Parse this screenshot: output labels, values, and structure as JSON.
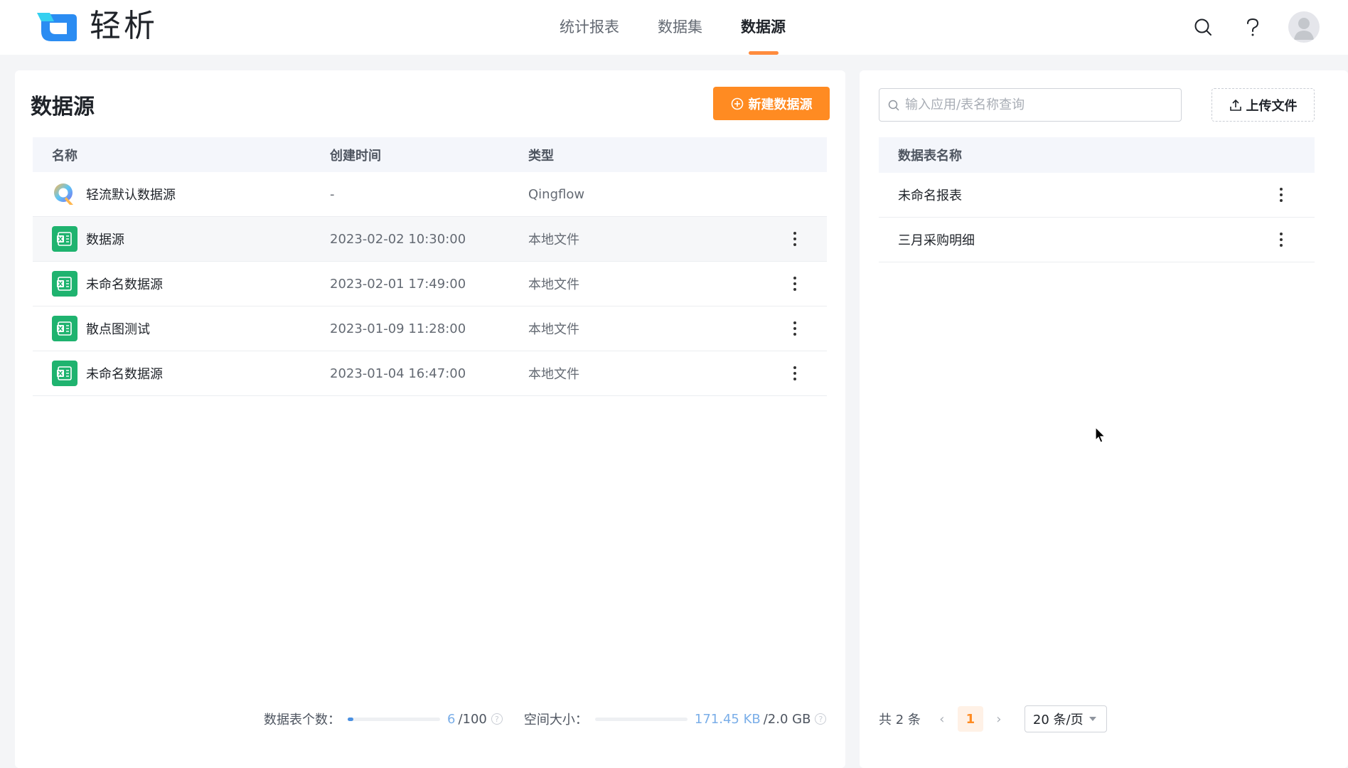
{
  "app": {
    "logo_text": "轻析",
    "nav": [
      {
        "label": "统计报表",
        "active": false
      },
      {
        "label": "数据集",
        "active": false
      },
      {
        "label": "数据源",
        "active": true
      }
    ],
    "accent_color": "#ff8b22",
    "icons": [
      "search-icon",
      "help-icon",
      "avatar"
    ]
  },
  "left": {
    "title": "数据源",
    "new_button_label": "新建数据源",
    "columns": [
      "名称",
      "创建时间",
      "类型"
    ],
    "rows": [
      {
        "icon": "qingflow-icon",
        "name": "轻流默认数据源",
        "time": "-",
        "type": "Qingflow",
        "has_more": false
      },
      {
        "icon": "excel-icon",
        "name": "数据源",
        "time": "2023-02-02 10:30:00",
        "type": "本地文件",
        "has_more": true
      },
      {
        "icon": "excel-icon",
        "name": "未命名数据源",
        "time": "2023-02-01 17:49:00",
        "type": "本地文件",
        "has_more": true
      },
      {
        "icon": "excel-icon",
        "name": "散点图测试",
        "time": "2023-01-09 11:28:00",
        "type": "本地文件",
        "has_more": true
      },
      {
        "icon": "excel-icon",
        "name": "未命名数据源",
        "time": "2023-01-04 16:47:00",
        "type": "本地文件",
        "has_more": true
      }
    ],
    "stats": {
      "table_count_label": "数据表个数：",
      "table_count_value": "6",
      "table_count_max": "/100",
      "table_count_fraction": 0.06,
      "space_label": "空间大小：",
      "space_value": "171.45 KB",
      "space_max": "/2.0 GB",
      "space_fraction": 0.0001
    }
  },
  "right": {
    "search_placeholder": "输入应用/表名称查询",
    "upload_label": "上传文件",
    "column": "数据表名称",
    "rows": [
      {
        "name": "未命名报表"
      },
      {
        "name": "三月采购明细"
      }
    ],
    "pager": {
      "total_label": "共 2 条",
      "current_page": "1",
      "page_size": "20 条/页"
    }
  }
}
